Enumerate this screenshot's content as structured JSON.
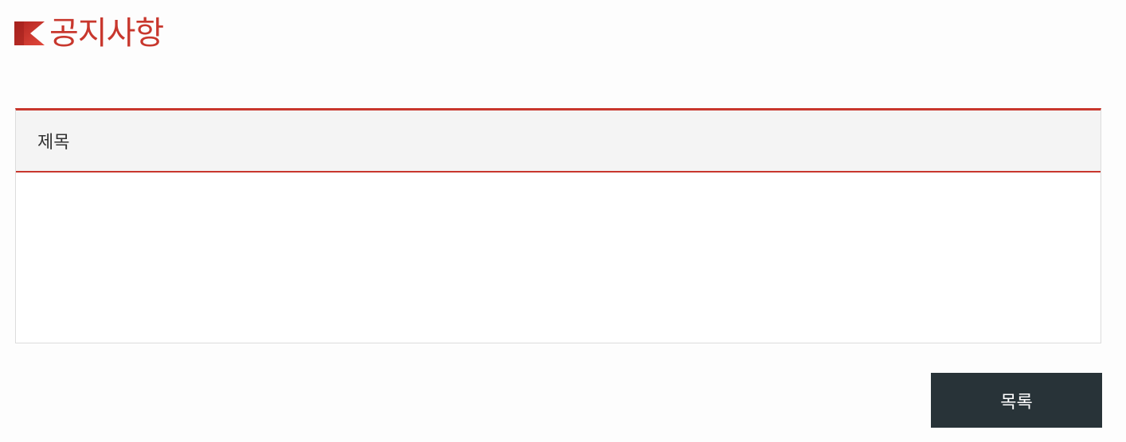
{
  "header": {
    "title": "공지사항",
    "icon": "red-flag-icon",
    "accent_color": "#c8372d"
  },
  "board": {
    "subject_label": "제목",
    "content": ""
  },
  "actions": {
    "list_label": "목록",
    "list_button_color": "#283338"
  }
}
